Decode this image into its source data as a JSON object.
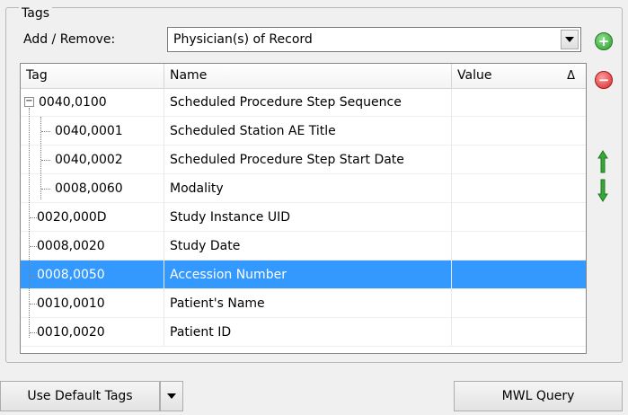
{
  "groupbox": {
    "title": "Tags"
  },
  "add_remove": {
    "label": "Add / Remove:",
    "selected_value": "Physician(s) of Record"
  },
  "grid": {
    "columns": [
      "Tag",
      "Name",
      "Value"
    ],
    "sort_indicator": "Δ",
    "rows": [
      {
        "tag": "0040,0100",
        "name": "Scheduled Procedure Step Sequence",
        "value": "",
        "level": 0,
        "expanded": true
      },
      {
        "tag": "0040,0001",
        "name": "Scheduled Station AE Title",
        "value": "",
        "level": 1
      },
      {
        "tag": "0040,0002",
        "name": "Scheduled Procedure Step Start Date",
        "value": "",
        "level": 1
      },
      {
        "tag": "0008,0060",
        "name": "Modality",
        "value": "",
        "level": 1
      },
      {
        "tag": "0020,000D",
        "name": "Study Instance UID",
        "value": "",
        "level": 0
      },
      {
        "tag": "0008,0020",
        "name": "Study Date",
        "value": "",
        "level": 0
      },
      {
        "tag": "0008,0050",
        "name": "Accession Number",
        "value": "",
        "level": 0,
        "selected": true
      },
      {
        "tag": "0010,0010",
        "name": "Patient's Name",
        "value": "",
        "level": 0
      },
      {
        "tag": "0010,0020",
        "name": "Patient ID",
        "value": "",
        "level": 0
      }
    ]
  },
  "side_buttons": {
    "add_icon": "plus-circle-icon",
    "remove_icon": "minus-circle-icon",
    "up_icon": "arrow-up-icon",
    "down_icon": "arrow-down-icon"
  },
  "bottom": {
    "default_tags_label": "Use Default Tags",
    "query_label": "MWL Query"
  },
  "colors": {
    "selection": "#3399ff",
    "add_green": "#2c9a2c",
    "remove_red": "#d42b2b",
    "arrow_green": "#3aa63a"
  }
}
